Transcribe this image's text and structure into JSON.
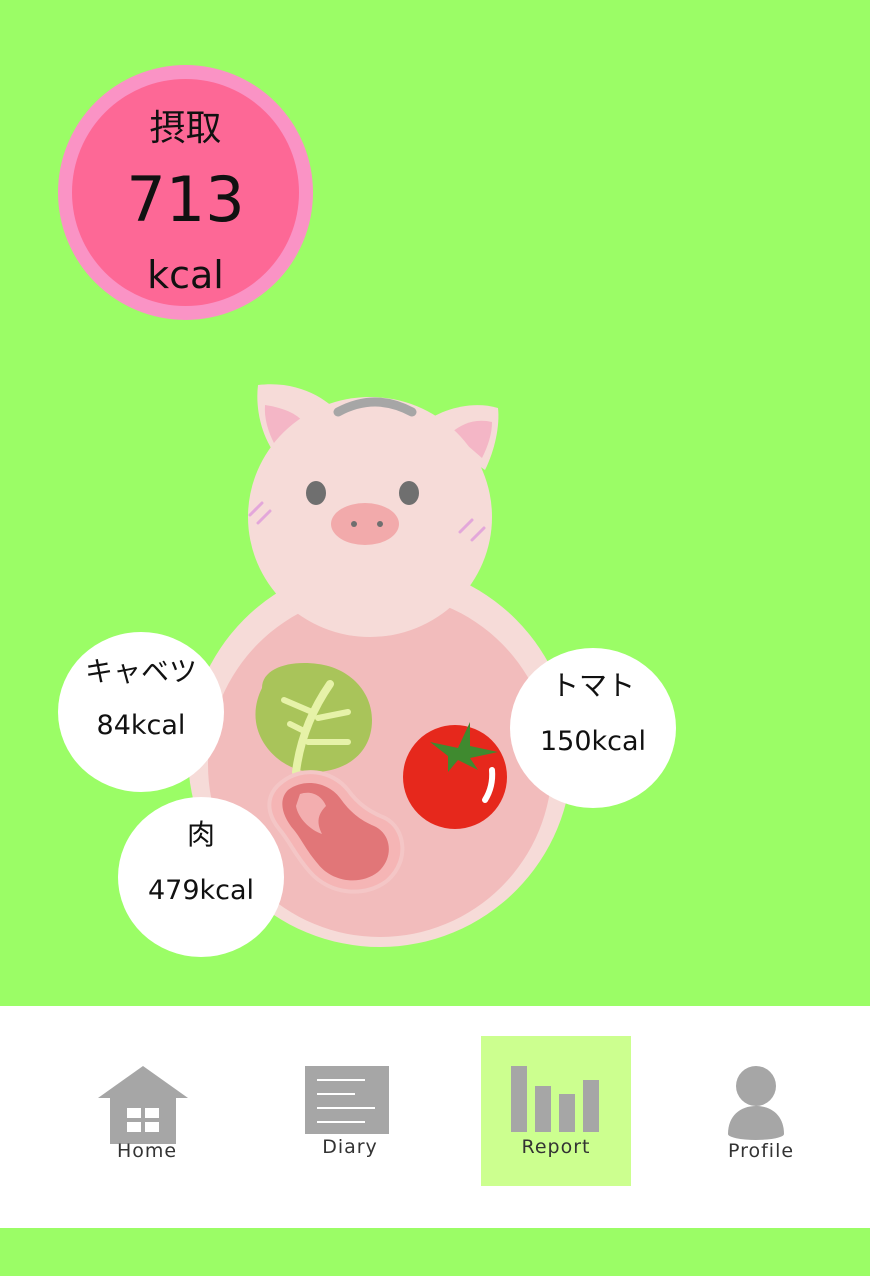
{
  "intake": {
    "label": "摂取",
    "value": "713",
    "unit": "kcal"
  },
  "foods": [
    {
      "name": "キャベツ",
      "kcal": "84kcal"
    },
    {
      "name": "肉",
      "kcal": "479kcal"
    },
    {
      "name": "トマト",
      "kcal": "150kcal"
    }
  ],
  "nav": {
    "items": [
      {
        "label": "Home",
        "icon": "home-icon"
      },
      {
        "label": "Diary",
        "icon": "diary-icon"
      },
      {
        "label": "Report",
        "icon": "report-icon",
        "active": true
      },
      {
        "label": "Profile",
        "icon": "profile-icon"
      }
    ]
  },
  "colors": {
    "background": "#9bfd66",
    "intake_ring": "#fa93c5",
    "intake_fill": "#fd6896",
    "nav_active": "#ccff8f",
    "icon_gray": "#a6a6a6"
  }
}
